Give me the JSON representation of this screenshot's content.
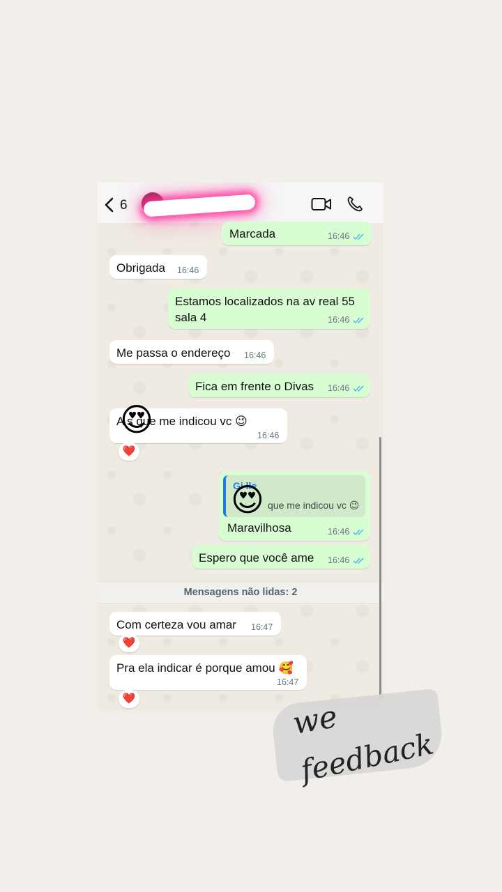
{
  "header": {
    "back_count": "6",
    "colors": {
      "header_bg": "#f6f6f6"
    },
    "icons": [
      "chevron-left-icon",
      "video-call-icon",
      "phone-call-icon"
    ]
  },
  "messages": [
    {
      "text": "Marcada",
      "time": "16:46",
      "direction": "out",
      "read": true
    },
    {
      "text": "Obrigada",
      "time": "16:46",
      "direction": "in"
    },
    {
      "text": "Estamos localizados na av real 55\nsala 4",
      "time": "16:46",
      "direction": "out",
      "read": true
    },
    {
      "text": "Me passa o endereço",
      "time": "16:46",
      "direction": "in"
    },
    {
      "text": "Fica em frente o Divas",
      "time": "16:46",
      "direction": "out",
      "read": true
    },
    {
      "text": "A     s que me indicou vc 😉",
      "time": "16:46",
      "direction": "in",
      "reaction": "❤️",
      "overlay_emoji": "😍"
    },
    {
      "quoted": {
        "name": "Gi   lle",
        "text": "que me indicou vc 😉"
      },
      "text": "Maravilhosa",
      "time": "16:46",
      "direction": "out",
      "read": true,
      "overlay_emoji": "😍"
    },
    {
      "text": "Espero que você ame",
      "time": "16:46",
      "direction": "out",
      "read": true
    },
    {
      "text": "Com certeza vou amar",
      "time": "16:47",
      "direction": "in",
      "reaction": "❤️"
    },
    {
      "text": "Pra ela indicar é porque amou 🥰",
      "time": "16:47",
      "direction": "in",
      "reaction": "❤️"
    }
  ],
  "unread_divider": "Mensagens não lidas: 2",
  "sticker": {
    "line1": "we",
    "line2": "feedback"
  },
  "colors": {
    "incoming_bubble": "#ffffff",
    "outgoing_bubble": "#d9fdd3",
    "read_ticks": "#53bdeb",
    "chat_background": "#efeae2",
    "page_background": "#f2efeb"
  }
}
